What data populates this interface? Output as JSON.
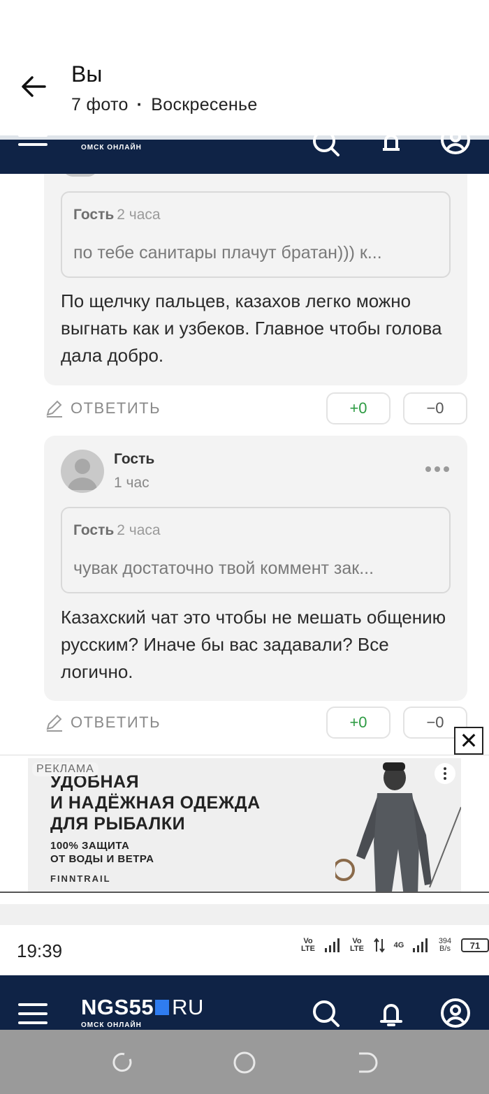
{
  "gallery": {
    "title": "Вы",
    "count": "7 фото",
    "day": "Воскресенье"
  },
  "comments": [
    {
      "quote_author": "Гость",
      "quote_time": "2 часа",
      "quote_text": "по тебе санитары плачут братан))) к...",
      "text": "По щелчку пальцев, казахов легко можно выгнать как и узбеков. Главное чтобы голова дала добро."
    },
    {
      "author": "Гость",
      "time": "1 час",
      "quote_author": "Гость",
      "quote_time": "2 часа",
      "quote_text": "чувак достаточно твой коммент зак...",
      "text": "Казахский чат это чтобы не мешать общению русским? Иначе бы вас задавали? Все логично."
    }
  ],
  "actions": {
    "reply_label": "ОТВЕТИТЬ",
    "plus_label": "+0",
    "minus_label": "−0"
  },
  "ad": {
    "label": "РЕКЛАМА",
    "line1": "УДОБНАЯ",
    "line2": "И НАДЁЖНАЯ ОДЕЖДА",
    "line3": "ДЛЯ РЫБАЛКИ",
    "small1": "100% ЗАЩИТА",
    "small2": "ОТ ВОДЫ И ВЕТРА",
    "brand": "FINNTRAIL",
    "close": "✕"
  },
  "status_bar": {
    "time": "19:39",
    "net1": "Vo LTE",
    "net2": "Vo LTE",
    "net3": "4G",
    "speed": "394 B/s",
    "battery": "71"
  },
  "site": {
    "logo": "NGS55",
    "logo_suffix": "RU",
    "logo_sub": "ОМСК ОНЛАЙН"
  },
  "colors": {
    "navy": "#0f2346",
    "accent": "#2f7cf0",
    "plus": "#2d9b43"
  }
}
